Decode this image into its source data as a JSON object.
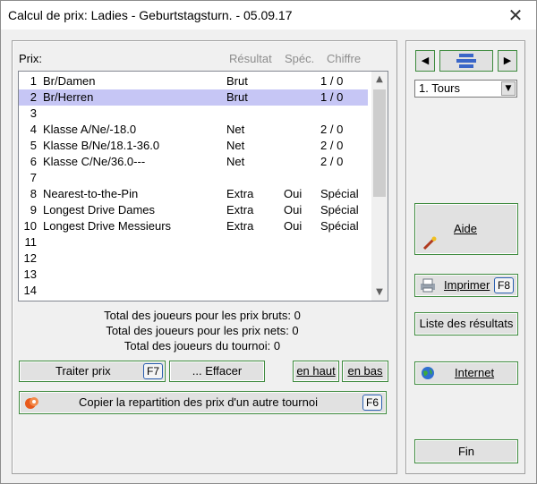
{
  "window": {
    "title": "Calcul de prix: Ladies - Geburtstagsturn. - 05.09.17",
    "close_glyph": "✕"
  },
  "headers": {
    "prix": "Prix:",
    "resultat": "Résultat",
    "spec": "Spéc.",
    "chiffre": "Chiffre"
  },
  "prizes": [
    {
      "num": "1",
      "name": "Br/Damen",
      "result": "Brut",
      "spec": "",
      "figure": "1 / 0",
      "selected": false
    },
    {
      "num": "2",
      "name": "Br/Herren",
      "result": "Brut",
      "spec": "",
      "figure": "1 / 0",
      "selected": true
    },
    {
      "num": "3",
      "name": "",
      "result": "",
      "spec": "",
      "figure": "",
      "selected": false
    },
    {
      "num": "4",
      "name": "Klasse A/Ne/-18.0",
      "result": "Net",
      "spec": "",
      "figure": "2 / 0",
      "selected": false
    },
    {
      "num": "5",
      "name": "Klasse B/Ne/18.1-36.0",
      "result": "Net",
      "spec": "",
      "figure": "2 / 0",
      "selected": false
    },
    {
      "num": "6",
      "name": "Klasse C/Ne/36.0---",
      "result": "Net",
      "spec": "",
      "figure": "2 / 0",
      "selected": false
    },
    {
      "num": "7",
      "name": "",
      "result": "",
      "spec": "",
      "figure": "",
      "selected": false
    },
    {
      "num": "8",
      "name": "Nearest-to-the-Pin",
      "result": "Extra",
      "spec": "Oui",
      "figure": "Spécial",
      "selected": false
    },
    {
      "num": "9",
      "name": "Longest Drive Dames",
      "result": "Extra",
      "spec": "Oui",
      "figure": "Spécial",
      "selected": false
    },
    {
      "num": "10",
      "name": "Longest Drive Messieurs",
      "result": "Extra",
      "spec": "Oui",
      "figure": "Spécial",
      "selected": false
    },
    {
      "num": "11",
      "name": "",
      "result": "",
      "spec": "",
      "figure": "",
      "selected": false
    },
    {
      "num": "12",
      "name": "",
      "result": "",
      "spec": "",
      "figure": "",
      "selected": false
    },
    {
      "num": "13",
      "name": "",
      "result": "",
      "spec": "",
      "figure": "",
      "selected": false
    },
    {
      "num": "14",
      "name": "",
      "result": "",
      "spec": "",
      "figure": "",
      "selected": false
    }
  ],
  "totals": {
    "brut": "Total des joueurs pour les prix bruts: 0",
    "net": "Total des joueurs pour les prix nets: 0",
    "tournoi": "Total des joueurs du tournoi: 0"
  },
  "buttons": {
    "traiter": "Traiter prix",
    "traiter_key": "F7",
    "effacer": "... Effacer",
    "en_haut": "en haut",
    "en_bas": "en bas",
    "copier": "Copier la repartition des prix d'un autre tournoi",
    "copier_key": "F6",
    "aide": "Aide",
    "imprimer": "Imprimer",
    "imprimer_key": "F8",
    "liste": "Liste des résultats",
    "internet": "Internet",
    "fin": "Fin"
  },
  "round_select": {
    "value": "1. Tours"
  },
  "icons": {
    "nav_prev": "◀",
    "nav_next": "▶",
    "scroll_up": "▲",
    "scroll_down": "▼",
    "dropdown": "▼"
  },
  "colors": {
    "selection": "#c6c6f5",
    "accent_border": "#3d8a3d",
    "fkey_border": "#2a5fb0"
  }
}
